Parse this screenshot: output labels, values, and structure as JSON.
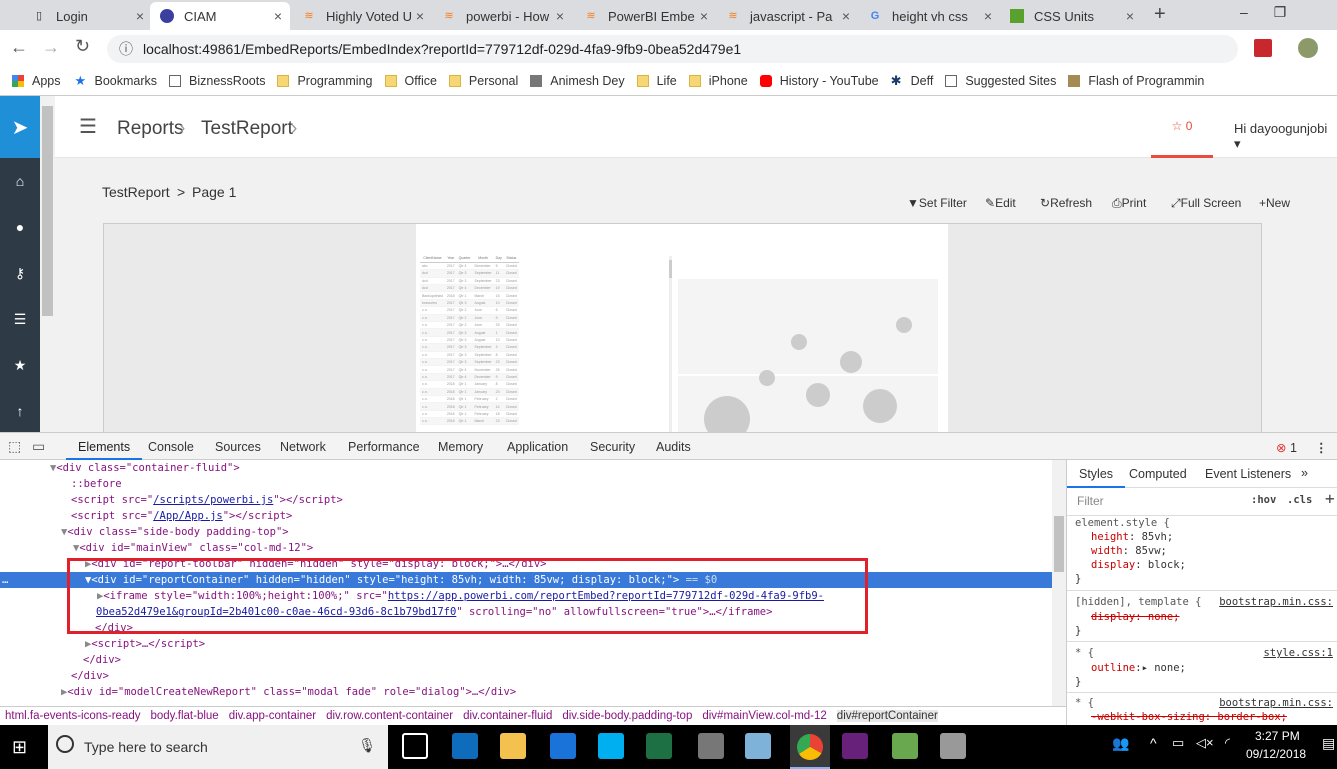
{
  "browser": {
    "tabs": [
      {
        "label": "Login"
      },
      {
        "label": "CIAM",
        "active": true
      },
      {
        "label": "Highly Voted U"
      },
      {
        "label": "powerbi - How"
      },
      {
        "label": "PowerBI Embe"
      },
      {
        "label": "javascript - Pa"
      },
      {
        "label": "height vh css"
      },
      {
        "label": "CSS Units"
      }
    ],
    "url": "localhost:49861/EmbedReports/EmbedIndex?reportId=779712df-029d-4fa9-9fb9-0bea52d479e1",
    "bookmarks": [
      "Apps",
      "Bookmarks",
      "BiznessRoots",
      "Programming",
      "Office",
      "Personal",
      "Animesh Dey",
      "Life",
      "iPhone",
      "History - YouTube",
      "Deff",
      "Suggested Sites",
      "Flash of Programmin"
    ]
  },
  "app": {
    "breadcrumb": [
      "Reports",
      "TestReport"
    ],
    "favorites_count": "0",
    "user_greeting": "Hi dayoogunjobi",
    "report_path": "TestReport",
    "page_label": "Page 1",
    "toolbar": [
      "Set Filter",
      "Edit",
      "Refresh",
      "Print",
      "Full Screen",
      "New"
    ],
    "report_table": {
      "columns": [
        "ClientName",
        "Year",
        "Quarter",
        "Month",
        "Day",
        "Status"
      ],
      "rows": [
        [
          "abc",
          "2017",
          "Qtr 4",
          "December",
          "5",
          "Closed"
        ],
        [
          "dcd",
          "2017",
          "Qtr 3",
          "September",
          "11",
          "Closed"
        ],
        [
          "dcd",
          "2017",
          "Qtr 3",
          "September",
          "23",
          "Closed"
        ],
        [
          "dcd",
          "2017",
          "Qtr 4",
          "December",
          "19",
          "Closed"
        ],
        [
          "Backupdesist",
          "2018",
          "Qtr 1",
          "March",
          "15",
          "Closed"
        ],
        [
          "bsecuries",
          "2017",
          "Qtr 3",
          "August",
          "10",
          "Closed"
        ],
        [
          "c.n.",
          "2017",
          "Qtr 2",
          "June",
          "6",
          "Closed"
        ],
        [
          "c.n.",
          "2017",
          "Qtr 2",
          "June",
          "9",
          "Closed"
        ],
        [
          "c.n.",
          "2017",
          "Qtr 2",
          "June",
          "29",
          "Closed"
        ],
        [
          "c.n.",
          "2017",
          "Qtr 3",
          "August",
          "1",
          "Closed"
        ],
        [
          "c.n.",
          "2017",
          "Qtr 3",
          "August",
          "10",
          "Closed"
        ],
        [
          "c.n.",
          "2017",
          "Qtr 3",
          "September",
          "4",
          "Closed"
        ],
        [
          "c.n.",
          "2017",
          "Qtr 3",
          "September",
          "8",
          "Closed"
        ],
        [
          "c.n.",
          "2017",
          "Qtr 3",
          "September",
          "23",
          "Closed"
        ],
        [
          "c.n.",
          "2017",
          "Qtr 4",
          "November",
          "25",
          "Closed"
        ],
        [
          "c.n.",
          "2017",
          "Qtr 4",
          "December",
          "9",
          "Closed"
        ],
        [
          "c.n.",
          "2018",
          "Qtr 1",
          "January",
          "8",
          "Closed"
        ],
        [
          "c.n.",
          "2018",
          "Qtr 1",
          "January",
          "23",
          "Closed"
        ],
        [
          "c.n.",
          "2018",
          "Qtr 1",
          "February",
          "2",
          "Closed"
        ],
        [
          "c.n.",
          "2018",
          "Qtr 1",
          "February",
          "14",
          "Closed"
        ],
        [
          "c.n.",
          "2018",
          "Qtr 1",
          "February",
          "18",
          "Closed"
        ],
        [
          "c.n.",
          "2018",
          "Qtr 1",
          "March",
          "23",
          "Closed"
        ]
      ]
    }
  },
  "devtools": {
    "tabs": [
      "Elements",
      "Console",
      "Sources",
      "Network",
      "Performance",
      "Memory",
      "Application",
      "Security",
      "Audits"
    ],
    "error_count": "1",
    "dom": {
      "l1": "<div class=\"container-fluid\">",
      "l2": "::before",
      "l3a": "<script src=\"",
      "l3b": "/scripts/powerbi.js",
      "l3c": "\"></script>",
      "l4a": "<script src=\"",
      "l4b": "/App/App.js",
      "l4c": "\"></script>",
      "l5": "<div class=\"side-body padding-top\">",
      "l6": "<div id=\"mainView\" class=\"col-md-12\">",
      "l7": "<div id=\"report-toolbar\" hidden=\"hidden\" style=\"display: block;\">…</div>",
      "l8": "<div id=\"reportContainer\" hidden=\"hidden\" style=\"height: 85vh; width: 85vw; display: block;\">",
      "l8b": "== $0",
      "l9a": "<iframe style=\"width:100%;height:100%;\" src=\"",
      "l9b": "https://app.powerbi.com/reportEmbed?reportId=779712df-029d-4fa9-9fb9-",
      "l10a": "0bea52d479e1&groupId=2b401c00-c0ae-46cd-93d6-8c1b79bd17f0",
      "l10b": "\" scrolling=\"no\" allowfullscreen=\"true\">…</iframe>",
      "l11": "</div>",
      "l12": "<script>…</script>",
      "l13": "</div>",
      "l14": "</div>",
      "l15": "<div id=\"modelCreateNewReport\" class=\"modal fade\" role=\"dialog\">…</div>"
    },
    "breadcrumb": [
      "html.fa-events-icons-ready",
      "body.flat-blue",
      "div.app-container",
      "div.row.content-container",
      "div.container-fluid",
      "div.side-body.padding-top",
      "div#mainView.col-md-12",
      "div#reportContainer"
    ],
    "styles": {
      "tabs": [
        "Styles",
        "Computed",
        "Event Listeners",
        "»"
      ],
      "filter_placeholder": "Filter",
      "hov": ":hov",
      "cls": ".cls",
      "r1_sel": "element.style {",
      "r1_p1": "height",
      "r1_v1": "85vh;",
      "r1_p2": "width",
      "r1_v2": "85vw;",
      "r1_p3": "display",
      "r1_v3": "block;",
      "r2_sel": "[hidden], template {",
      "r2_src": "bootstrap.min.css:",
      "r2_p": "display: none;",
      "r3_sel": "* {",
      "r3_src": "style.css:1",
      "r3_p": "outline",
      "r3_v": "▸ none;",
      "r4_sel": "* {",
      "r4_src": "bootstrap.min.css:",
      "r4_p": "-webkit-box-sizing: border-box;",
      "close": "}"
    }
  },
  "taskbar": {
    "search_placeholder": "Type here to search",
    "time": "3:27 PM",
    "date": "09/12/2018"
  }
}
